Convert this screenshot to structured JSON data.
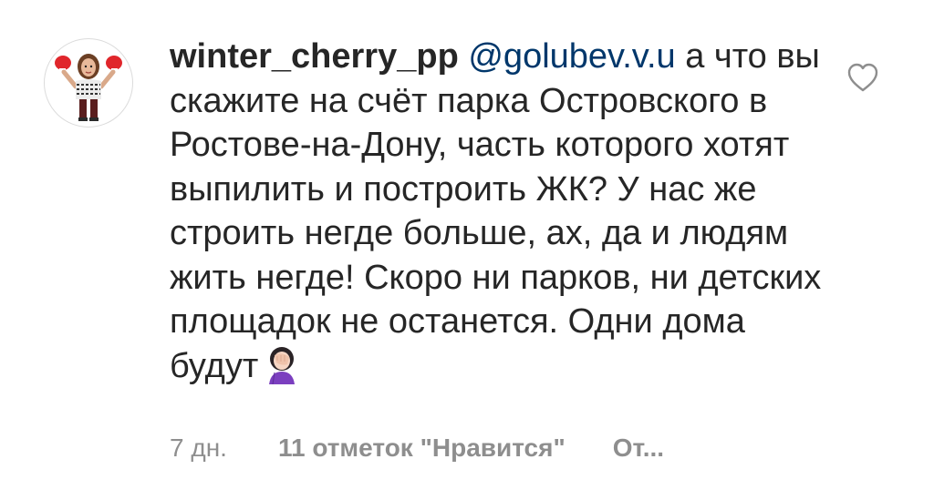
{
  "comment": {
    "username": "winter_cherry_pp",
    "mention": "@golubev.v.u",
    "text_after_mention": " а что вы скажите на счёт парка Островского в Ростове-на-Дону, часть которого хотят выпилить и построить ЖК? У нас же строить негде больше, ах, да и людям жить негде! Скоро ни парков, ни детских площадок не останется. Одни дома будут",
    "emoji": "face-palm-woman-emoji"
  },
  "meta": {
    "time": "7 дн.",
    "likes": "11 отметок \"Нравится\"",
    "reply": "От..."
  },
  "icons": {
    "avatar": "bitmoji-avatar-boxing-gloves",
    "like": "heart-outline-icon"
  },
  "colors": {
    "text": "#262626",
    "mention": "#00376b",
    "secondary": "#8e8e8e",
    "border": "#dbdbdb"
  }
}
